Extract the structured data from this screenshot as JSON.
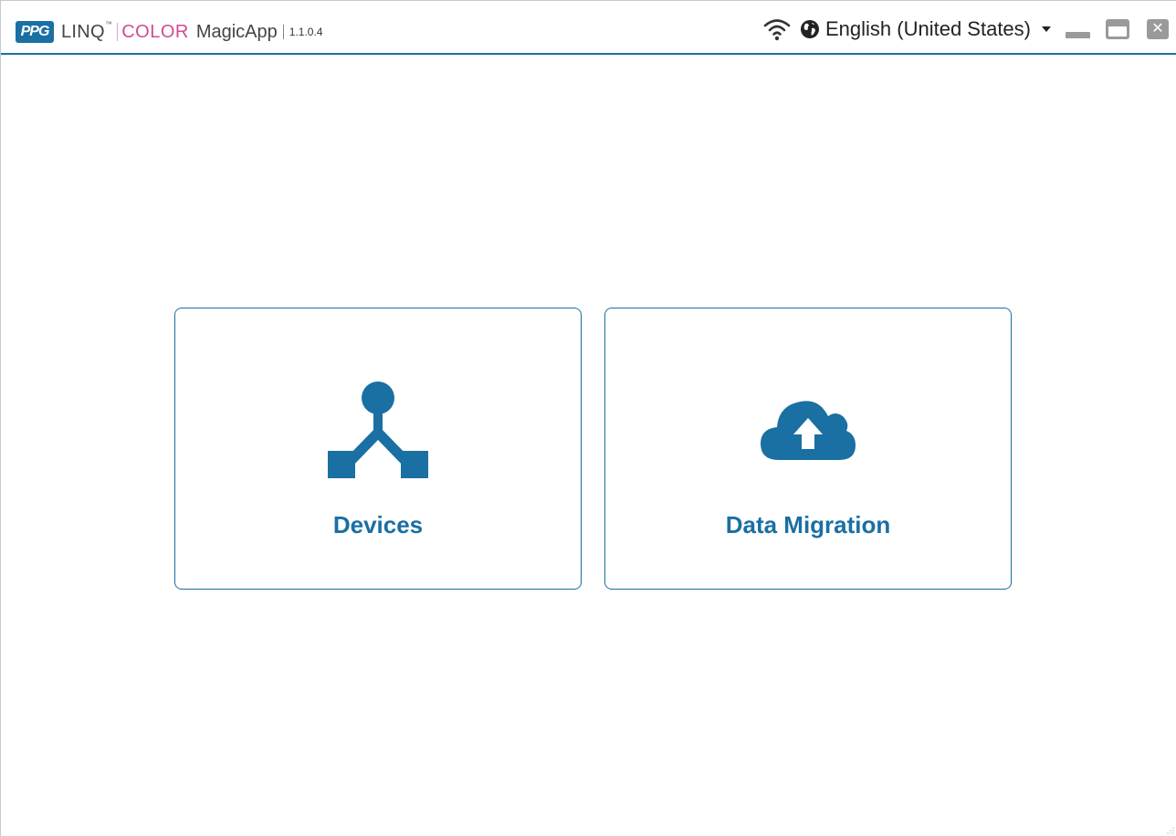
{
  "titlebar": {
    "logo_text": "PPG",
    "app_name_linq": "LINQ",
    "trademark": "™",
    "app_name_color": "COLOR",
    "app_name_magic": "MagicApp",
    "version": "1.1.0.4",
    "language": "English (United States)",
    "icons": {
      "wifi": "wifi-icon",
      "globe": "globe-icon",
      "minimize": "minimize-icon",
      "maximize": "maximize-icon",
      "close": "close-icon"
    },
    "close_glyph": "✕"
  },
  "main": {
    "cards": [
      {
        "label": "Devices",
        "icon": "devices-network-icon"
      },
      {
        "label": "Data Migration",
        "icon": "cloud-upload-icon"
      }
    ]
  },
  "colors": {
    "accent": "#1a6fa3",
    "brand_pink": "#d04a95",
    "window_control_gray": "#9a9a9a"
  }
}
